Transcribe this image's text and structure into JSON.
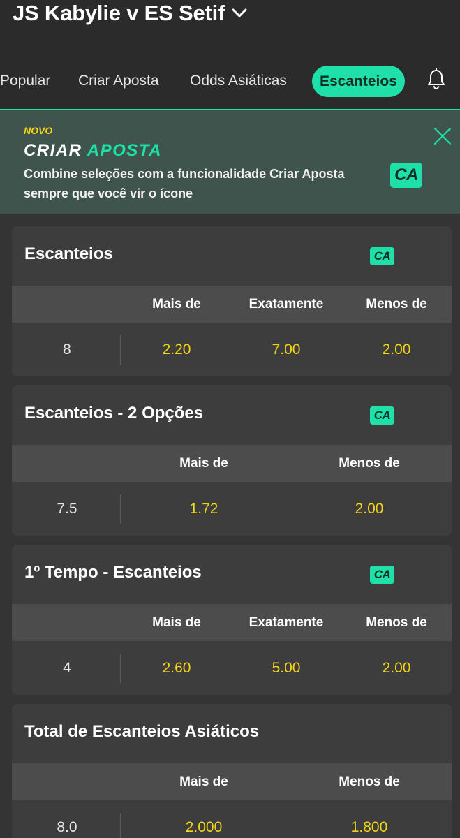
{
  "header": {
    "match_title": "JS Kabylie v ES Setif",
    "tabs": [
      {
        "label": "Popular",
        "active": false
      },
      {
        "label": "Criar Aposta",
        "active": false
      },
      {
        "label": "Odds Asiáticas",
        "active": false
      },
      {
        "label": "Escanteios",
        "active": true
      }
    ],
    "bell_icon": "bell-icon",
    "chevron_icon": "chevron-down-icon"
  },
  "promo": {
    "tag": "NOVO",
    "title_part1": "CRIAR",
    "title_part2": "APOSTA",
    "description": "Combine seleções com a funcionalidade Criar Aposta sempre que você vir o ícone",
    "badge": "CA",
    "close_icon": "close-icon"
  },
  "markets": [
    {
      "title": "Escanteios",
      "badge": "CA",
      "columns": [
        "Mais de",
        "Exatamente",
        "Menos de"
      ],
      "line": "8",
      "odds": [
        "2.20",
        "7.00",
        "2.00"
      ]
    },
    {
      "title": "Escanteios - 2 Opções",
      "badge": "CA",
      "columns": [
        "Mais de",
        "Menos de"
      ],
      "line": "7.5",
      "odds": [
        "1.72",
        "2.00"
      ]
    },
    {
      "title": "1º Tempo - Escanteios",
      "badge": "CA",
      "columns": [
        "Mais de",
        "Exatamente",
        "Menos de"
      ],
      "line": "4",
      "odds": [
        "2.60",
        "5.00",
        "2.00"
      ]
    },
    {
      "title": "Total de Escanteios Asiáticos",
      "columns": [
        "Mais de",
        "Menos de"
      ],
      "line": "8.0",
      "odds": [
        "2.000",
        "1.800"
      ]
    }
  ],
  "colors": {
    "accent": "#1ee0a8",
    "odds": "#f5d416",
    "background": "#333433",
    "card": "#3c3d3c"
  }
}
